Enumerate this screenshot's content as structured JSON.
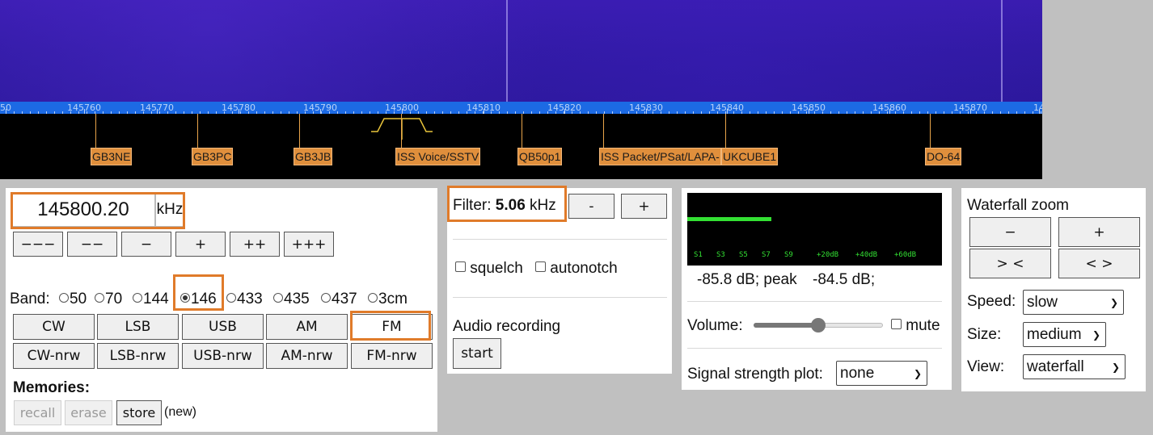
{
  "spectrum": {
    "scale_labels": [
      "50",
      "145760",
      "145770",
      "145780",
      "145790",
      "145800",
      "145810",
      "145820",
      "145830",
      "145840",
      "145850",
      "145860",
      "145870",
      "14"
    ],
    "markers": [
      "GB3NE",
      "GB3PC",
      "GB3JB",
      "ISS Voice/SSTV",
      "QB50p1",
      "ISS Packet/PSat/LAPA-",
      "UKCUBE1",
      "DO-64"
    ]
  },
  "tuning": {
    "frequency": "145800.20",
    "unit": "kHz",
    "step_buttons": [
      "−−−",
      "−−",
      "−",
      "+",
      "++",
      "+++"
    ]
  },
  "band": {
    "label": "Band:",
    "options": [
      "50",
      "70",
      "144",
      "146",
      "433",
      "435",
      "437",
      "3cm"
    ],
    "selected": "146"
  },
  "modes": {
    "row1": [
      "CW",
      "LSB",
      "USB",
      "AM",
      "FM"
    ],
    "row2": [
      "CW-nrw",
      "LSB-nrw",
      "USB-nrw",
      "AM-nrw",
      "FM-nrw"
    ],
    "selected": "FM"
  },
  "memories": {
    "label": "Memories:",
    "recall": "recall",
    "erase": "erase",
    "store": "store",
    "note": "(new)"
  },
  "filter": {
    "label": "Filter:",
    "value": "5.06",
    "unit": "kHz",
    "minus": "-",
    "plus": "+"
  },
  "options": {
    "squelch": "squelch",
    "autonotch": "autonotch"
  },
  "recording": {
    "label": "Audio recording",
    "start": "start"
  },
  "meter": {
    "scale": [
      "S1",
      "S3",
      "S5",
      "S7",
      "S9",
      "+20dB",
      "+40dB",
      "+60dB"
    ],
    "level_fraction": 0.33,
    "readout": "-85.8 dB; peak",
    "peak": "-84.5 dB;"
  },
  "volume": {
    "label": "Volume:",
    "level": 0.5,
    "mute": "mute"
  },
  "plot": {
    "label": "Signal strength plot:",
    "value": "none"
  },
  "waterfall": {
    "title": "Waterfall zoom",
    "zoom_out": "−",
    "zoom_in": "+",
    "narrow": "> <",
    "widen": "< >",
    "speed_label": "Speed:",
    "speed": "slow",
    "size_label": "Size:",
    "size": "medium",
    "view_label": "View:",
    "view": "waterfall"
  },
  "colors": {
    "highlight": "#e07b2a",
    "scale_bar": "#1c6ae4",
    "marker": "#e08f3c",
    "meter_bar": "#33e033"
  }
}
